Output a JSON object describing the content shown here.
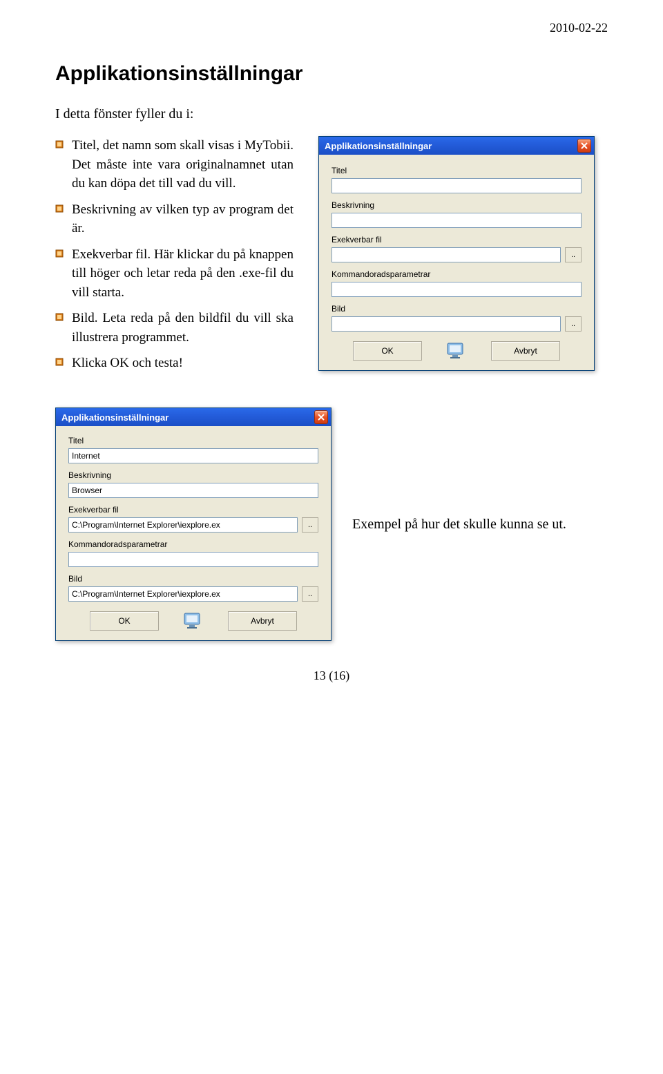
{
  "header": {
    "date": "2010-02-22"
  },
  "title": "Applikationsinställningar",
  "intro": "I detta fönster fyller du i:",
  "bullets": [
    "Titel, det namn som skall visas i MyTobii. Det måste inte vara originalnamnet utan du kan döpa det till vad du vill.",
    "Beskrivning av vilken typ av program det är.",
    "Exekverbar fil. Här klickar du på knappen till höger och letar reda på den .exe-fil du vill starta.",
    "Bild. Leta reda på den bildfil du vill ska illustrera programmet.",
    "Klicka OK och testa!"
  ],
  "dialog1": {
    "title": "Applikationsinställningar",
    "labels": {
      "titel": "Titel",
      "beskrivning": "Beskrivning",
      "exe": "Exekverbar fil",
      "kommando": "Kommandoradsparametrar",
      "bild": "Bild"
    },
    "values": {
      "titel": "",
      "beskrivning": "",
      "exe": "",
      "kommando": "",
      "bild": ""
    },
    "browse": "..",
    "ok": "OK",
    "cancel": "Avbryt"
  },
  "dialog2": {
    "title": "Applikationsinställningar",
    "labels": {
      "titel": "Titel",
      "beskrivning": "Beskrivning",
      "exe": "Exekverbar fil",
      "kommando": "Kommandoradsparametrar",
      "bild": "Bild"
    },
    "values": {
      "titel": "Internet",
      "beskrivning": "Browser",
      "exe": "C:\\Program\\Internet Explorer\\iexplore.ex",
      "kommando": "",
      "bild": "C:\\Program\\Internet Explorer\\iexplore.ex"
    },
    "browse": "..",
    "ok": "OK",
    "cancel": "Avbryt"
  },
  "caption": "Exempel på hur det skulle kunna se ut.",
  "pageNumber": "13 (16)"
}
